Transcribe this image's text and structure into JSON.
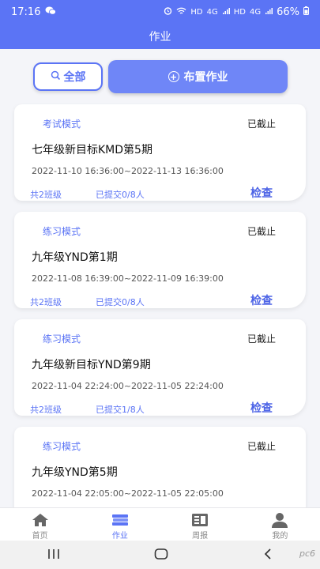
{
  "statusbar": {
    "time": "17:16",
    "chat_icon": "wechat-icon",
    "battery": "66%",
    "net1": "HD",
    "net2": "4G",
    "net3": "HD",
    "net4": "4G"
  },
  "header": {
    "title": "作业"
  },
  "filters": {
    "all_label": "全部",
    "assign_label": "布置作业"
  },
  "cards": [
    {
      "mode": "考试模式",
      "status": "已截止",
      "title": "七年级新目标KMD第5期",
      "date": "2022-11-10 16:36:00~2022-11-13 16:36:00",
      "classes": "共2班级",
      "submitted": "已提交0/8人",
      "action": "检查"
    },
    {
      "mode": "练习模式",
      "status": "已截止",
      "title": "九年级YND第1期",
      "date": "2022-11-08 16:39:00~2022-11-09 16:39:00",
      "classes": "共2班级",
      "submitted": "已提交0/8人",
      "action": "检查"
    },
    {
      "mode": "练习模式",
      "status": "已截止",
      "title": "九年级新目标YND第9期",
      "date": "2022-11-04 22:24:00~2022-11-05 22:24:00",
      "classes": "共2班级",
      "submitted": "已提交1/8人",
      "action": "检查"
    },
    {
      "mode": "练习模式",
      "status": "已截止",
      "title": "九年级YND第5期",
      "date": "2022-11-04 22:05:00~2022-11-05 22:05:00",
      "classes": "",
      "submitted": "",
      "action": ""
    }
  ],
  "tabs": [
    {
      "label": "首页",
      "icon": "home-icon"
    },
    {
      "label": "作业",
      "icon": "books-icon"
    },
    {
      "label": "周报",
      "icon": "report-icon"
    },
    {
      "label": "我的",
      "icon": "profile-icon"
    }
  ],
  "colors": {
    "primary": "#5b74f5",
    "assign_button": "#6f86f7"
  },
  "watermark": "pc6"
}
